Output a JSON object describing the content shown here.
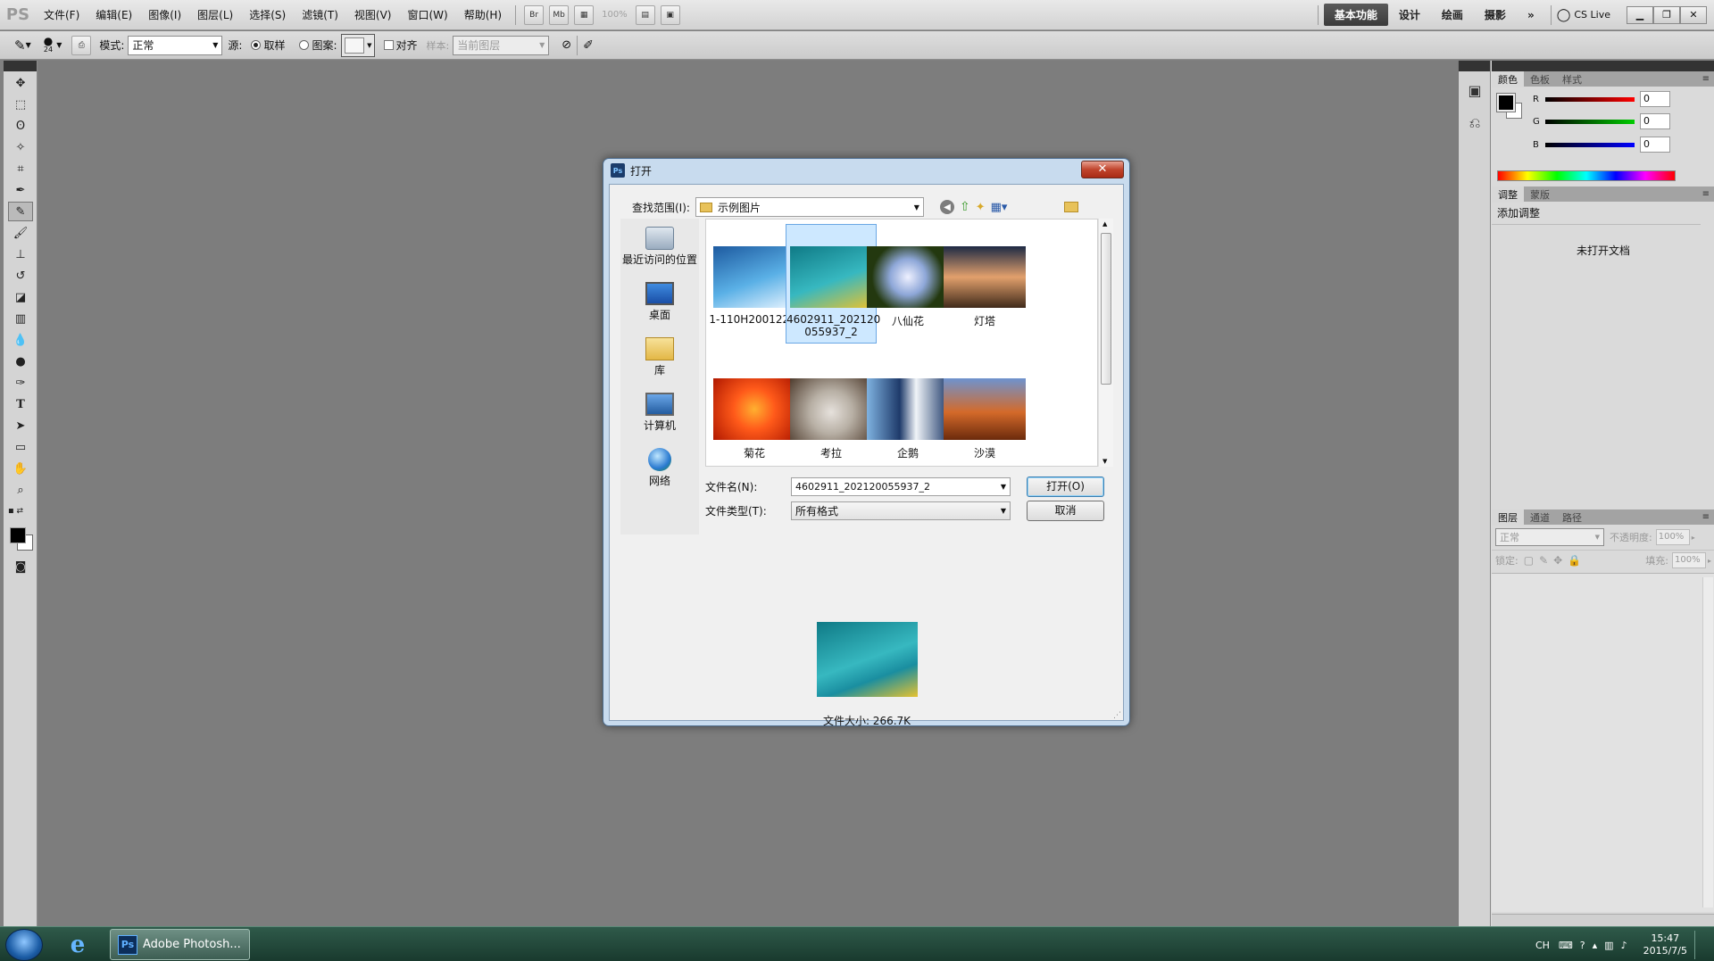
{
  "menubar": {
    "logo": "PS",
    "items": [
      "文件(F)",
      "编辑(E)",
      "图像(I)",
      "图层(L)",
      "选择(S)",
      "滤镜(T)",
      "视图(V)",
      "窗口(W)",
      "帮助(H)"
    ],
    "br_label": "Br",
    "mb_label": "Mb",
    "zoom": "100%",
    "workspaces": [
      "基本功能",
      "设计",
      "绘画",
      "摄影"
    ],
    "more": "»",
    "cslive": "CS Live"
  },
  "options": {
    "brush_size": "24",
    "mode_label": "模式:",
    "mode_value": "正常",
    "source_label": "源:",
    "sampled_label": "取样",
    "pattern_label": "图案:",
    "aligned_label": "对齐",
    "sample_label": "样本:",
    "sample_value": "当前图层"
  },
  "dialog": {
    "title": "打开",
    "close": "✕",
    "look_in_label": "查找范围(I):",
    "look_in_value": "示例图片",
    "places": [
      {
        "label": "最近访问的位置",
        "icon": "recent-places-icon"
      },
      {
        "label": "桌面",
        "icon": "desktop-icon"
      },
      {
        "label": "库",
        "icon": "libraries-icon"
      },
      {
        "label": "计算机",
        "icon": "computer-icon"
      },
      {
        "label": "网络",
        "icon": "network-icon"
      }
    ],
    "files": [
      {
        "name": "1-110H200122...",
        "colors": [
          "#1d5aa0",
          "#5ab0e6",
          "#e8f4ff"
        ]
      },
      {
        "name": "4602911_202120055937_2",
        "line1": "4602911_202120",
        "line2": "055937_2",
        "colors": [
          "#0f7a86",
          "#37b8c0",
          "#e6c230"
        ]
      },
      {
        "name": "八仙花",
        "colors": [
          "#23380f",
          "#8ea7d8",
          "#eef0ff"
        ]
      },
      {
        "name": "灯塔",
        "colors": [
          "#1d2a44",
          "#e2a06c",
          "#402a1a"
        ]
      },
      {
        "name": "菊花",
        "colors": [
          "#b01800",
          "#ff5a1a",
          "#ffb030"
        ]
      },
      {
        "name": "考拉",
        "colors": [
          "#4e3b2d",
          "#b8b0a5",
          "#e6e1dc"
        ]
      },
      {
        "name": "企鹅",
        "colors": [
          "#1e3a6a",
          "#7fb2e0",
          "#f0f4f8"
        ]
      },
      {
        "name": "沙漠",
        "colors": [
          "#6b2a0c",
          "#d46a2a",
          "#6e93cf"
        ]
      }
    ],
    "filename_label": "文件名(N):",
    "filename_value": "4602911_202120055937_2",
    "filetype_label": "文件类型(T):",
    "filetype_value": "所有格式",
    "open_button": "打开(O)",
    "cancel_button": "取消",
    "filesize": "文件大小: 266.7K"
  },
  "panels": {
    "color_tabs": [
      "颜色",
      "色板",
      "样式"
    ],
    "r_label": "R",
    "g_label": "G",
    "b_label": "B",
    "r_value": "0",
    "g_value": "0",
    "b_value": "0",
    "adjust_tabs": [
      "调整",
      "蒙版"
    ],
    "adjust_title": "添加调整",
    "no_document": "未打开文档",
    "layers_tabs": [
      "图层",
      "通道",
      "路径"
    ],
    "blend_mode": "正常",
    "opacity_label": "不透明度:",
    "opacity_value": "100%",
    "lock_label": "锁定:",
    "fill_label": "填充:",
    "fill_value": "100%"
  },
  "taskbar": {
    "ps_label": "Adobe Photosh...",
    "lang": "CH",
    "time": "15:47",
    "date": "2015/7/5"
  }
}
